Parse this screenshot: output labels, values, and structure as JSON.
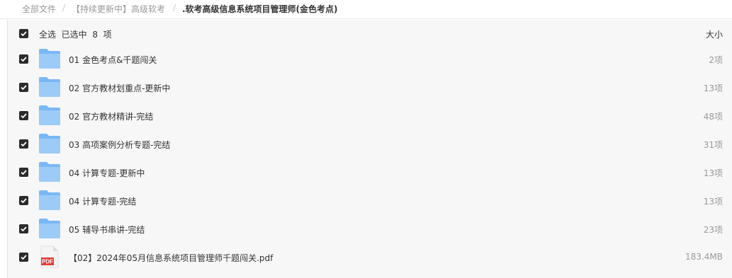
{
  "breadcrumb": {
    "root": "全部文件",
    "parent": "【持续更新中】高级软考",
    "current": ".软考高级信息系统项目管理师(金色考点)",
    "separator": "/"
  },
  "list": {
    "select_all_label": "全选",
    "selected_label": "已选中",
    "selected_count": "8",
    "selected_unit": "项",
    "size_header": "大小",
    "items": [
      {
        "name": "01 金色考点&千题闯关",
        "size": "2项",
        "type": "folder",
        "checked": true
      },
      {
        "name": "02 官方教材划重点-更新中",
        "size": "13项",
        "type": "folder",
        "checked": true
      },
      {
        "name": "02 官方教材精讲-完结",
        "size": "48项",
        "type": "folder",
        "checked": true
      },
      {
        "name": "03 高项案例分析专题-完结",
        "size": "31项",
        "type": "folder",
        "checked": true
      },
      {
        "name": "04 计算专题-更新中",
        "size": "13项",
        "type": "folder",
        "checked": true
      },
      {
        "name": "04 计算专题-完结",
        "size": "13项",
        "type": "folder",
        "checked": true
      },
      {
        "name": "05 辅导书串讲-完结",
        "size": "23项",
        "type": "folder",
        "checked": true
      },
      {
        "name": "【02】2024年05月信息系统项目管理师千题闯关.pdf",
        "size": "183.4MB",
        "type": "pdf",
        "checked": true
      }
    ]
  },
  "icons": {
    "pdf_label": "PDF"
  },
  "colors": {
    "folder": "#7ab8f5",
    "pdf": "#e03a3a",
    "checkbox": "#2b2b2b"
  }
}
